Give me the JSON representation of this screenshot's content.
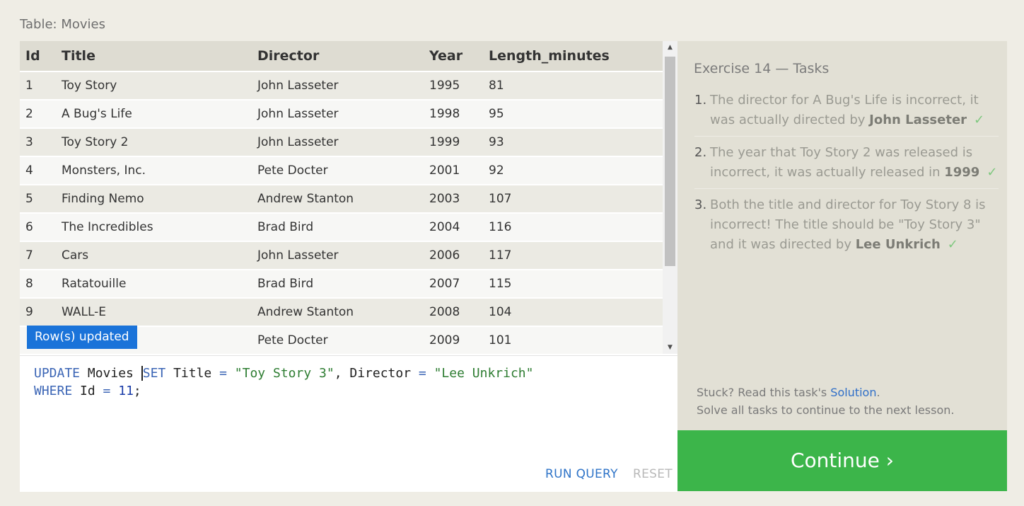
{
  "table": {
    "caption": "Table: Movies",
    "columns": [
      "Id",
      "Title",
      "Director",
      "Year",
      "Length_minutes"
    ],
    "rows": [
      [
        "1",
        "Toy Story",
        "John Lasseter",
        "1995",
        "81"
      ],
      [
        "2",
        "A Bug's Life",
        "John Lasseter",
        "1998",
        "95"
      ],
      [
        "3",
        "Toy Story 2",
        "John Lasseter",
        "1999",
        "93"
      ],
      [
        "4",
        "Monsters, Inc.",
        "Pete Docter",
        "2001",
        "92"
      ],
      [
        "5",
        "Finding Nemo",
        "Andrew Stanton",
        "2003",
        "107"
      ],
      [
        "6",
        "The Incredibles",
        "Brad Bird",
        "2004",
        "116"
      ],
      [
        "7",
        "Cars",
        "John Lasseter",
        "2006",
        "117"
      ],
      [
        "8",
        "Ratatouille",
        "Brad Bird",
        "2007",
        "115"
      ],
      [
        "9",
        "WALL-E",
        "Andrew Stanton",
        "2008",
        "104"
      ],
      [
        "",
        "",
        "Pete Docter",
        "2009",
        "101"
      ]
    ]
  },
  "toast": "Row(s) updated",
  "editor": {
    "line1": {
      "kw1": "UPDATE",
      "t1": " Movies ",
      "kw2": "SET",
      "t2": " Title ",
      "op1": "=",
      "t3": " ",
      "s1": "\"Toy Story 3\"",
      "t4": ", Director ",
      "op2": "=",
      "t5": " ",
      "s2": "\"Lee Unkrich\""
    },
    "line2": {
      "kw1": "WHERE",
      "t1": " Id ",
      "op1": "=",
      "t2": " ",
      "n1": "11",
      "t3": ";"
    }
  },
  "actions": {
    "run": "RUN QUERY",
    "reset": "RESET"
  },
  "exercise": {
    "title": "Exercise 14 — Tasks",
    "tasks": [
      {
        "num": "1.",
        "pre": "The director for A Bug's Life is incorrect, it was actually directed by ",
        "bold": "John Lasseter",
        "check": "✓"
      },
      {
        "num": "2.",
        "pre": "The year that Toy Story 2 was released is incorrect, it was actually released in ",
        "bold": "1999",
        "check": "✓"
      },
      {
        "num": "3.",
        "pre": "Both the title and director for Toy Story 8 is incorrect! The title should be \"Toy Story 3\" and it was directed by ",
        "bold": "Lee Unkrich",
        "check": "✓"
      }
    ],
    "help_prefix": "Stuck? Read this task's ",
    "help_link": "Solution",
    "help_suffix": ".",
    "help_line2": "Solve all tasks to continue to the next lesson."
  },
  "continue_label": "Continue ›",
  "colors": {
    "accent": "#3cb54a",
    "link": "#2f6fc8",
    "toast": "#1a73d9"
  }
}
